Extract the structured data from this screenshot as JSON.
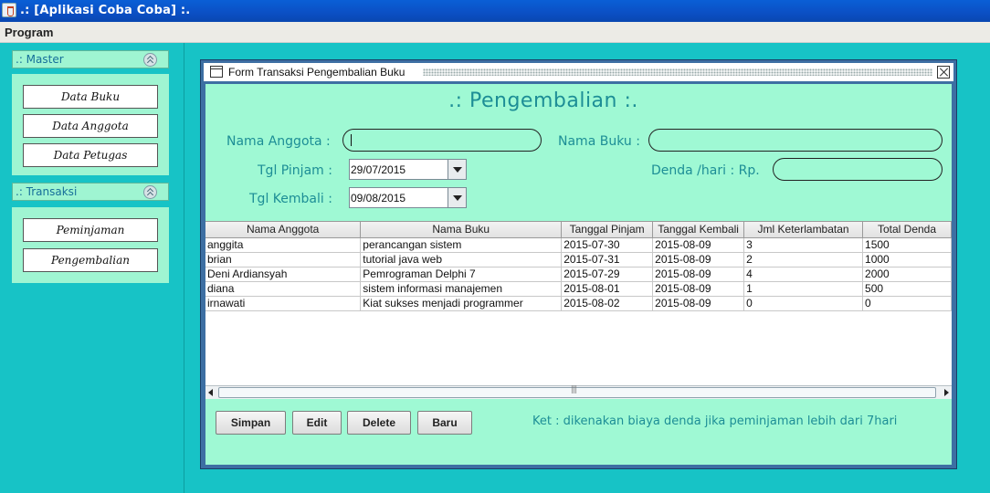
{
  "window": {
    "title": ".: [Aplikasi Coba Coba] :."
  },
  "menubar": {
    "items": [
      "Program"
    ]
  },
  "sidebar": {
    "groups": [
      {
        "title": ".: Master",
        "items": [
          "Data Buku",
          "Data Anggota",
          "Data Petugas"
        ]
      },
      {
        "title": ".: Transaksi",
        "items": [
          "Peminjaman",
          "Pengembalian"
        ]
      }
    ]
  },
  "frame": {
    "title": "Form Transaksi Pengembalian Buku",
    "heading": ".: Pengembalian :.",
    "form": {
      "nama_anggota_label": "Nama Anggota :",
      "nama_anggota_value": "",
      "nama_buku_label": "Nama Buku :",
      "nama_buku_value": "",
      "tgl_pinjam_label": "Tgl Pinjam :",
      "tgl_pinjam_value": "29/07/2015",
      "tgl_kembali_label": "Tgl Kembali :",
      "tgl_kembali_value": "09/08/2015",
      "denda_label": "Denda /hari : Rp.",
      "denda_value": ""
    },
    "table": {
      "columns": [
        "Nama Anggota",
        "Nama Buku",
        "Tanggal Pinjam",
        "Tanggal Kembali",
        "Jml Keterlambatan",
        "Total Denda"
      ],
      "rows": [
        [
          "anggita",
          "perancangan sistem",
          "2015-07-30",
          "2015-08-09",
          "3",
          "1500"
        ],
        [
          "brian",
          "tutorial java web",
          "2015-07-31",
          "2015-08-09",
          "2",
          "1000"
        ],
        [
          "Deni Ardiansyah",
          "Pemrograman Delphi 7",
          "2015-07-29",
          "2015-08-09",
          "4",
          "2000"
        ],
        [
          "diana",
          "sistem informasi manajemen",
          "2015-08-01",
          "2015-08-09",
          "1",
          "500"
        ],
        [
          "irnawati",
          "Kiat sukses menjadi programmer",
          "2015-08-02",
          "2015-08-09",
          "0",
          "0"
        ]
      ]
    },
    "buttons": {
      "simpan": "Simpan",
      "edit": "Edit",
      "delete": "Delete",
      "baru": "Baru"
    },
    "ket": "Ket : dikenakan biaya denda jika peminjaman lebih dari 7hari"
  }
}
